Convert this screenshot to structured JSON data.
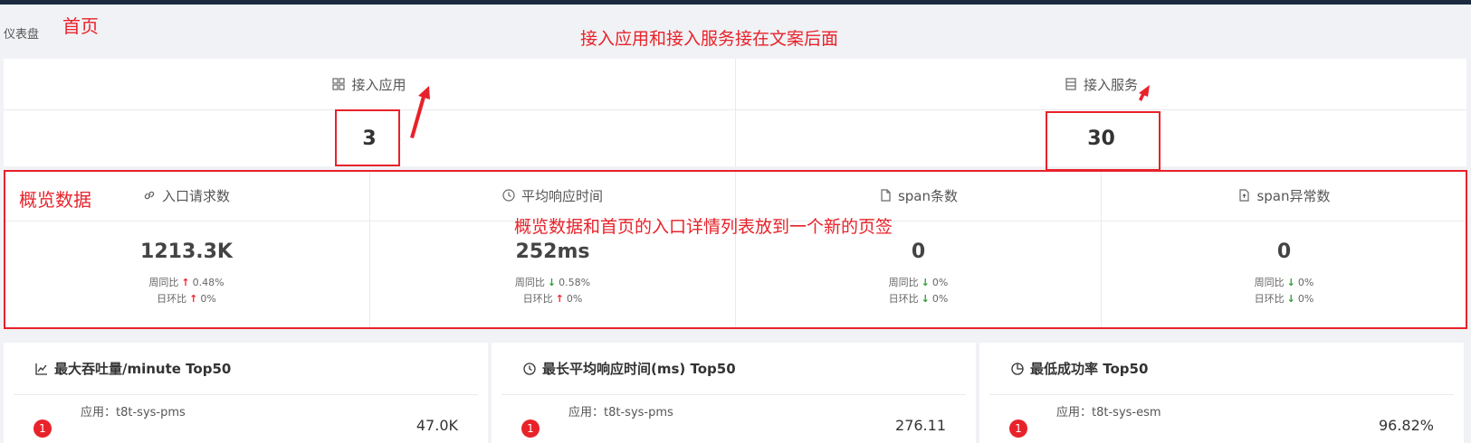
{
  "breadcrumb": "仪表盘",
  "annotations": {
    "home": "首页",
    "top_note": "接入应用和接入服务接在文案后面",
    "overview_label": "概览数据",
    "tab_note": "概览数据和首页的入口详情列表放到一个新的页签"
  },
  "access": {
    "apps_label": "接入应用",
    "apps_value": "3",
    "services_label": "接入服务",
    "services_value": "30"
  },
  "overview": [
    {
      "label": "入口请求数",
      "icon": "link-icon",
      "value": "1213.3K",
      "wow_label": "周同比",
      "wow_dir": "up",
      "wow_value": "0.48%",
      "dod_label": "日环比",
      "dod_dir": "up",
      "dod_value": "0%"
    },
    {
      "label": "平均响应时间",
      "icon": "clock-icon",
      "value": "252ms",
      "wow_label": "周同比",
      "wow_dir": "down",
      "wow_value": "0.58%",
      "dod_label": "日环比",
      "dod_dir": "up",
      "dod_value": "0%"
    },
    {
      "label": "span条数",
      "icon": "file-icon",
      "value": "0",
      "wow_label": "周同比",
      "wow_dir": "down",
      "wow_value": "0%",
      "dod_label": "日环比",
      "dod_dir": "down",
      "dod_value": "0%"
    },
    {
      "label": "span异常数",
      "icon": "file-upload-icon",
      "value": "0",
      "wow_label": "周同比",
      "wow_dir": "down",
      "wow_value": "0%",
      "dod_label": "日环比",
      "dod_dir": "down",
      "dod_value": "0%"
    }
  ],
  "top_cards": [
    {
      "title": "最大吞吐量/minute Top50",
      "icon": "line-chart-icon",
      "rank": "1",
      "app_prefix": "应用：",
      "app": "t8t-sys-pms",
      "value": "47.0K"
    },
    {
      "title": "最长平均响应时间(ms) Top50",
      "icon": "clock-icon",
      "rank": "1",
      "app_prefix": "应用：",
      "app": "t8t-sys-pms",
      "value": "276.11"
    },
    {
      "title": "最低成功率 Top50",
      "icon": "pie-chart-icon",
      "rank": "1",
      "app_prefix": "应用：",
      "app": "t8t-sys-esm",
      "value": "96.82%"
    }
  ],
  "colors": {
    "annotation": "#e8222a",
    "up": "#f5222d",
    "down": "#2e9d2e",
    "topbar": "#1b2a3f"
  }
}
